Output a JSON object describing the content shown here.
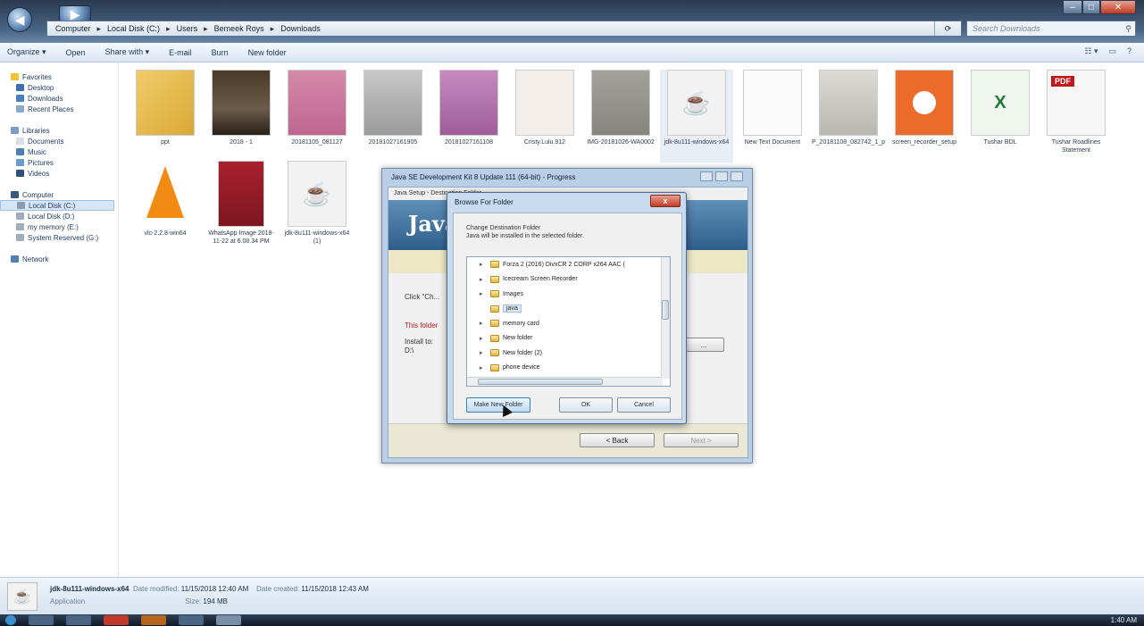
{
  "window": {
    "nav": {
      "back_icon": "back-arrow-icon",
      "forward_icon": "forward-arrow-icon"
    },
    "breadcrumb": [
      "Computer",
      "Local Disk (C:)",
      "Users",
      "Bemeek Roys",
      "Downloads"
    ],
    "search_placeholder": "Search Downloads",
    "controls": {
      "minimize": "–",
      "maximize": "□",
      "close": "✕"
    }
  },
  "toolbar": {
    "organize": "Organize ▾",
    "open": "Open",
    "share_with": "Share with ▾",
    "email": "E-mail",
    "burn": "Burn",
    "new_folder": "New folder"
  },
  "sidebar": {
    "favorites": "Favorites",
    "desktop": "Desktop",
    "downloads": "Downloads",
    "recent_places": "Recent Places",
    "libraries": "Libraries",
    "documents": "Documents",
    "music": "Music",
    "pictures": "Pictures",
    "videos": "Videos",
    "computer": "Computer",
    "local_disk_c": "Local Disk (C:)",
    "local_disk_d": "Local Disk (D:)",
    "my_memory_e": "my memory (E:)",
    "system_reserved_g": "System Reserved (G:)",
    "network": "Network"
  },
  "files": [
    {
      "name": "ppt",
      "thumb_color": "#e3b94b"
    },
    {
      "name": "2018 - 1",
      "thumb_color": "#5a4a3a"
    },
    {
      "name": "20181105_081127",
      "thumb_color": "#c9739a"
    },
    {
      "name": "20181027161905",
      "thumb_color": "#b5b5b5"
    },
    {
      "name": "20181027161108",
      "thumb_color": "#b87ab0"
    },
    {
      "name": "Cristy.Lulu.912",
      "thumb_color": "#f0ebe8"
    },
    {
      "name": "IMG-20181026-WA0002",
      "thumb_color": "#9a9a90"
    },
    {
      "name": "jdk-8u111-windows-x64",
      "thumb_color": "#f2f2f2"
    },
    {
      "name": "New Text Document",
      "thumb_color": "#fbfbfb"
    },
    {
      "name": "P_20181108_082742_1_p",
      "thumb_color": "#cfcfc8"
    },
    {
      "name": "screen_recorder_setup",
      "thumb_color": "#ec6a2a"
    },
    {
      "name": "Tushar BDL",
      "thumb_color": "#e8f3e8"
    },
    {
      "name": "Tushar Roadlines Statement",
      "thumb_color": "#f3f3f3"
    },
    {
      "name": "vlc-2.2.8-win64",
      "thumb_color": "#f28b13"
    },
    {
      "name": "WhatsApp Image 2018-11-22 at 6.08.34 PM",
      "thumb_color": "#9b1d2a"
    },
    {
      "name": "jdk-8u111-windows-x64 (1)",
      "thumb_color": "#f2f2f2"
    }
  ],
  "details": {
    "name": "jdk-8u111-windows-x64",
    "modified_label": "Date modified:",
    "modified": "11/15/2018 12:40 AM",
    "created_label": "Date created:",
    "created": "11/15/2018 12:43 AM",
    "type": "Application",
    "size_label": "Size:",
    "size": "194 MB"
  },
  "installer": {
    "title": "Java SE Development Kit 8 Update 111 (64-bit) - Progress",
    "subtitle": "Java Setup - Destination Folder",
    "logo_text": "Java",
    "click_text": "Click \"Ch...",
    "red_text": "This folder",
    "install_text": "Install to:",
    "install_path": "D:\\",
    "back_button": "< Back",
    "next_button": "Next >"
  },
  "browse_dialog": {
    "title": "Browse For Folder",
    "close": "x",
    "desc_line1": "Change Destination Folder",
    "desc_line2": "Java will be installed in the selected folder.",
    "tree": [
      {
        "label": "Forza 2 (2016) DivxCR 2 CORP x264 AAC (",
        "selected": false
      },
      {
        "label": "Icecream Screen Recorder",
        "selected": false
      },
      {
        "label": "Images",
        "selected": false
      },
      {
        "label": "java",
        "selected": true
      },
      {
        "label": "memory card",
        "selected": false
      },
      {
        "label": "New folder",
        "selected": false
      },
      {
        "label": "New folder (2)",
        "selected": false
      },
      {
        "label": "phone device",
        "selected": false
      }
    ],
    "make_new_folder": "Make New Folder",
    "ok": "OK",
    "cancel": "Cancel"
  },
  "taskbar": {
    "time": "1:40 AM"
  }
}
